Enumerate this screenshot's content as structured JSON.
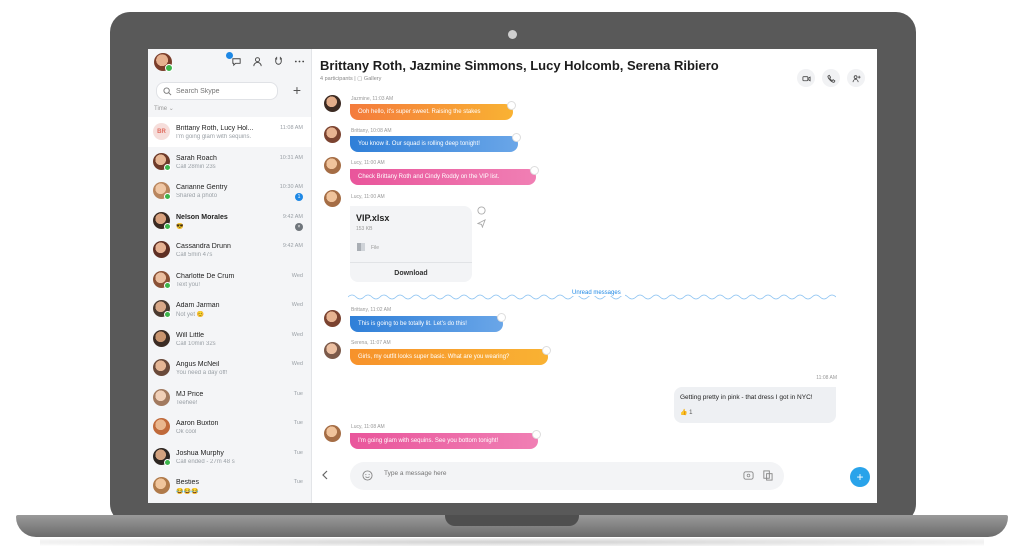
{
  "colors": {
    "accent": "#1e88e5",
    "send": "#29a3ea",
    "bubble_orange": "#f5903a",
    "bubble_blue": "#4a90d9",
    "bubble_pink": "#ec5fa0",
    "bubble_amber": "#f7a12a"
  },
  "sidebar": {
    "search_placeholder": "Search Skype",
    "sort_label": "Time ⌄",
    "conversations": [
      {
        "name": "Brittany Roth, Lucy Hol...",
        "sub": "I'm going glam with sequins.",
        "time": "11:08 AM",
        "initials": "BR",
        "active": true
      },
      {
        "name": "Sarah Roach",
        "sub": "Call 28min 23s",
        "time": "10:31 AM"
      },
      {
        "name": "Carianne Gentry",
        "sub": "Shared a photo",
        "time": "10:30 AM",
        "badge": "1"
      },
      {
        "name": "Nelson Morales",
        "sub": "😎",
        "time": "9:42 AM",
        "badge_gray": "×",
        "bold": true
      },
      {
        "name": "Cassandra Drunn",
        "sub": "Call 5min 47s",
        "time": "9:42 AM"
      },
      {
        "name": "Charlotte De Crum",
        "sub": "Text you!",
        "time": "Wed"
      },
      {
        "name": "Adam Jarman",
        "sub": "Not yet 😊",
        "time": "Wed"
      },
      {
        "name": "Will Little",
        "sub": "Call 10min 32s",
        "time": "Wed"
      },
      {
        "name": "Angus McNeil",
        "sub": "You need a day off!",
        "time": "Wed"
      },
      {
        "name": "MJ Price",
        "sub": "Teehee!",
        "time": "Tue"
      },
      {
        "name": "Aaron Buxton",
        "sub": "Ok cool",
        "time": "Tue"
      },
      {
        "name": "Joshua Murphy",
        "sub": "Call ended - 27m 48 s",
        "time": "Tue"
      },
      {
        "name": "Besties",
        "sub": "😂😂😂",
        "time": "Tue"
      }
    ]
  },
  "chat": {
    "title": "Brittany Roth, Jazmine Simmons, Lucy Holcomb, Serena Ribiero",
    "subtitle": "4 participants  |  ▢ Gallery",
    "messages": [
      {
        "meta": "Jazmine, 11:03 AM",
        "text": "Ooh hello, it's super sweet. Raising the stakes"
      },
      {
        "meta": "Brittany, 10:08 AM",
        "text": "You know it. Our squad is rolling deep tonight!"
      },
      {
        "meta": "Lucy, 11:00 AM",
        "text": "Check Brittany Roth and Cindy Roddy on the VIP list."
      },
      {
        "meta": "Lucy, 11:00 AM"
      },
      {
        "meta": "Brittany, 11:02 AM",
        "text": "This is going to be totally lit. Let's do this!"
      },
      {
        "meta": "Serena, 11:07 AM",
        "text": "Girls, my outfit looks super basic. What are you wearing?"
      },
      {
        "meta": "Lucy, 11:08 AM",
        "text": "I'm going glam with sequins. See you bottom tonight!"
      }
    ],
    "file": {
      "name": "VIP.xlsx",
      "size": "153 KB",
      "type": "File",
      "download_label": "Download"
    },
    "unread_label": "Unread messages",
    "outgoing": {
      "time": "11:08 AM",
      "text": "Getting pretty in pink - that dress I got in NYC!",
      "reaction": "👍 1"
    },
    "composer_placeholder": "Type a message here"
  }
}
